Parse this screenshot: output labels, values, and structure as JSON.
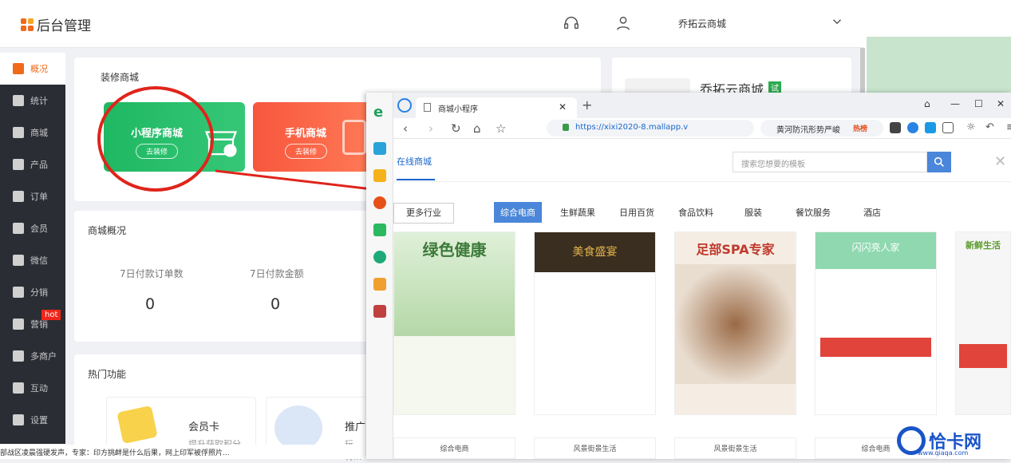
{
  "header": {
    "title": "后台管理",
    "store": "乔拓云商城"
  },
  "sidebar": {
    "items": [
      {
        "label": "概况",
        "icon": "layers-icon",
        "active": true
      },
      {
        "label": "统计",
        "icon": "stats-icon"
      },
      {
        "label": "商城",
        "icon": "store-icon"
      },
      {
        "label": "产品",
        "icon": "grid-icon"
      },
      {
        "label": "订单",
        "icon": "order-icon"
      },
      {
        "label": "会员",
        "icon": "crown-icon"
      },
      {
        "label": "微信",
        "icon": "wechat-icon"
      },
      {
        "label": "分销",
        "icon": "people-icon"
      },
      {
        "label": "营销",
        "icon": "flag-icon",
        "badge": "hot"
      },
      {
        "label": "多商户",
        "icon": "merchant-icon"
      },
      {
        "label": "互动",
        "icon": "interact-icon"
      },
      {
        "label": "设置",
        "icon": "gear-icon"
      }
    ]
  },
  "decorate": {
    "title": "装修商城",
    "miniapp": {
      "title": "小程序商城",
      "btn": "去装修"
    },
    "mobile": {
      "title": "手机商城",
      "btn": "去装修"
    }
  },
  "store_card": {
    "name": "乔拓云商城",
    "badge": "试"
  },
  "overview": {
    "title": "商城概况",
    "stats": [
      {
        "label": "7日付款订单数",
        "value": "0"
      },
      {
        "label": "7日付款金额",
        "value": "0"
      }
    ]
  },
  "hot": {
    "title": "热门功能",
    "items": [
      {
        "title": "会员卡",
        "desc": "提升获取积分..."
      },
      {
        "title": "推广",
        "desc": "玩转..."
      }
    ]
  },
  "browser": {
    "tab": "商城小程序",
    "url": "https://xixi2020-8.mallapp.v",
    "search": "黄河防汛形势严峻",
    "hot_label": "热榜",
    "win": [
      "⌂",
      "—",
      "☐",
      "✕"
    ]
  },
  "site": {
    "tab": "在线商城",
    "search_placeholder": "搜索您想要的模板",
    "more": "更多行业",
    "categories": [
      "综合电商",
      "生鲜蔬果",
      "日用百货",
      "食品饮料",
      "服装",
      "餐饮服务",
      "酒店"
    ],
    "thumbs": [
      {
        "headline": "绿色健康",
        "label": "综合电商",
        "color": "#3d7a3a",
        "bg": "#e8f3e0"
      },
      {
        "headline": "美食盛宴",
        "label": "风景街景生活",
        "color": "#8a5a12",
        "bg": "#2c2a28"
      },
      {
        "headline": "足部SPA专家",
        "label": "风景街景生活",
        "color": "#c0392b",
        "bg": "#f5ede4"
      },
      {
        "headline": "闪闪亮人家",
        "label": "综合电商",
        "color": "#2eaa70",
        "bg": "#8fd8b0"
      },
      {
        "headline": "新鲜生活",
        "label": "",
        "color": "#5a9a2a",
        "bg": "#f6f6f6"
      }
    ]
  },
  "watermark": {
    "text": "恰卡网",
    "sub": "www.qiaqa.com"
  },
  "ticker": "部战区凌晨强硬发声，专家：印方挑衅是什么后果，网上印军被俘照片..."
}
